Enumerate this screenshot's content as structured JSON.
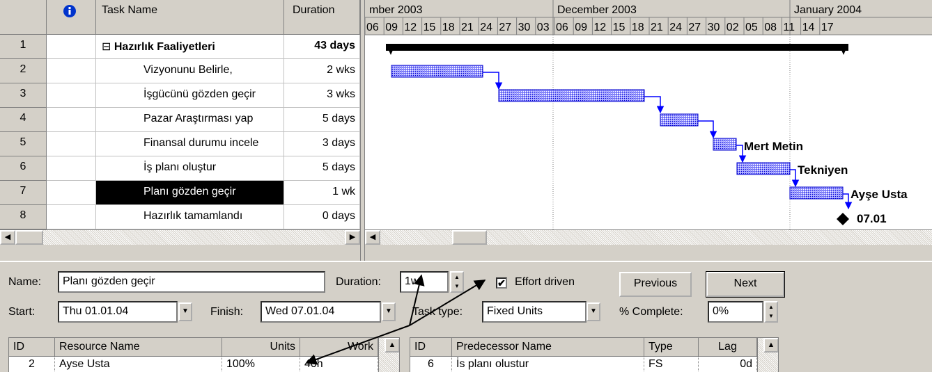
{
  "grid": {
    "headers": {
      "info_icon": "info-icon",
      "name": "Task Name",
      "duration": "Duration"
    },
    "rows": [
      {
        "id": "1",
        "name": "Hazırlık Faaliyetleri",
        "duration": "43 days",
        "summary": true,
        "collapse": "⊟"
      },
      {
        "id": "2",
        "name": "Vizyonunu Belirle,",
        "duration": "2 wks"
      },
      {
        "id": "3",
        "name": "İşgücünü gözden geçir",
        "duration": "3 wks"
      },
      {
        "id": "4",
        "name": "Pazar Araştırması yap",
        "duration": "5 days"
      },
      {
        "id": "5",
        "name": "Finansal durumu incele",
        "duration": "3 days"
      },
      {
        "id": "6",
        "name": "İş planı oluştur",
        "duration": "5 days"
      },
      {
        "id": "7",
        "name": "Planı gözden geçir",
        "duration": "1 wk",
        "selected": true
      },
      {
        "id": "8",
        "name": "Hazırlık tamamlandı",
        "duration": "0 days"
      }
    ]
  },
  "gantt": {
    "months": [
      "mber 2003",
      "December 2003",
      "January 2004"
    ],
    "days": [
      "06",
      "09",
      "12",
      "15",
      "18",
      "21",
      "24",
      "27",
      "30",
      "03",
      "06",
      "09",
      "12",
      "15",
      "18",
      "21",
      "24",
      "27",
      "30",
      "02",
      "05",
      "08",
      "11",
      "14",
      "17"
    ],
    "resource_labels": {
      "row5": "Mert Metin",
      "row6": "Tekniyen",
      "row7": "Ayşe Usta"
    },
    "milestone_label": "07.01",
    "bar_color": "#0000ff"
  },
  "form": {
    "name_label": "Name:",
    "name_value": "Planı gözden geçir",
    "duration_label": "Duration:",
    "duration_value": "1w",
    "effort_label": "Effort driven",
    "effort_checked": "✔",
    "previous": "Previous",
    "next": "Next",
    "start_label": "Start:",
    "start_value": "Thu 01.01.04",
    "finish_label": "Finish:",
    "finish_value": "Wed 07.01.04",
    "task_type_label": "Task type:",
    "task_type_value": "Fixed Units",
    "complete_label": "% Complete:",
    "complete_value": "0%",
    "resources": {
      "headers": [
        "ID",
        "Resource Name",
        "Units",
        "Work"
      ],
      "row": [
        "2",
        "Ayse Usta",
        "100%",
        "40h"
      ]
    },
    "predecessors": {
      "headers": [
        "ID",
        "Predecessor Name",
        "Type",
        "Lag"
      ],
      "row": [
        "6",
        "İs planı olustur",
        "FS",
        "0d"
      ]
    }
  }
}
